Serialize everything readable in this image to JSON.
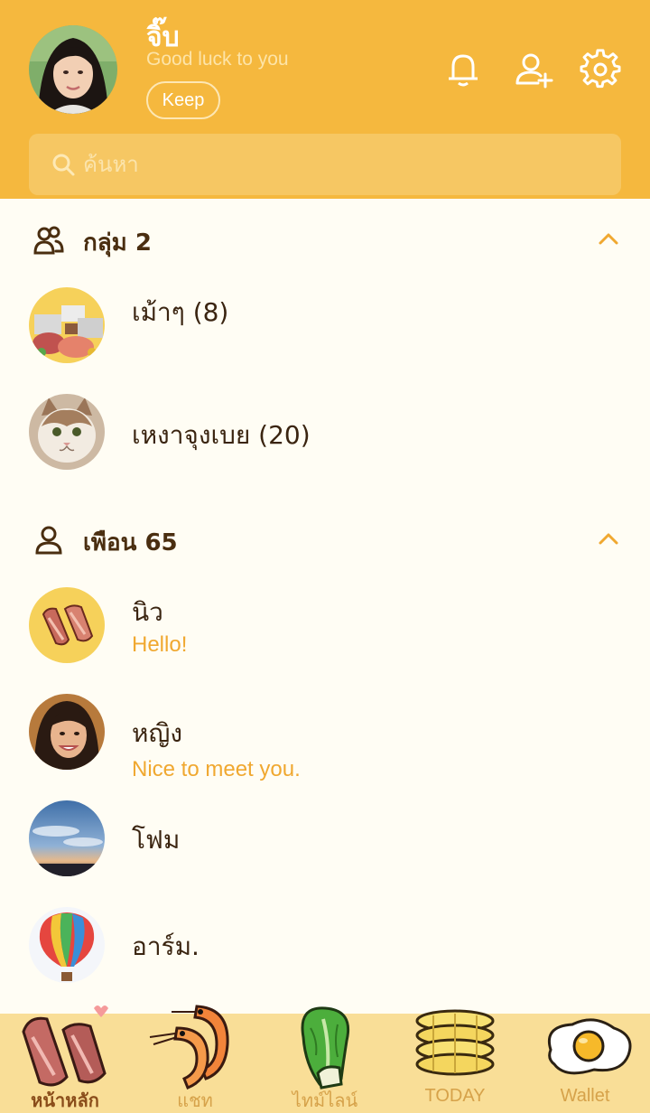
{
  "profile": {
    "name": "จิ๊บ",
    "status": "Good luck to you",
    "keep_label": "Keep"
  },
  "header_icons": [
    "bell-icon",
    "add-friend-icon",
    "gear-icon"
  ],
  "search": {
    "placeholder": "ค้นหา"
  },
  "groups": {
    "title": "กลุ่ม 2",
    "items": [
      {
        "name": "เม้าๆ (8)",
        "avatar": "food-platter-avatar"
      },
      {
        "name": "เหงาจุงเบย (20)",
        "avatar": "cat-avatar"
      }
    ]
  },
  "friends": {
    "title": "เพือน 65",
    "items": [
      {
        "name": "นิว",
        "message": "Hello!",
        "avatar": "bacon-avatar"
      },
      {
        "name": "หญิง",
        "message": "Nice to meet you.",
        "avatar": "woman-photo-avatar"
      },
      {
        "name": "โฟม",
        "message": "",
        "avatar": "sky-photo-avatar"
      },
      {
        "name": "อาร์ม.",
        "message": "",
        "avatar": "hot-air-balloon-avatar"
      }
    ]
  },
  "nav": {
    "items": [
      {
        "label": "หน้าหลัก",
        "icon": "bacon-icon",
        "active": true
      },
      {
        "label": "แชท",
        "icon": "shrimp-icon",
        "active": false
      },
      {
        "label": "ไทม์ไลน์",
        "icon": "cabbage-icon",
        "active": false
      },
      {
        "label": "TODAY",
        "icon": "corn-icon",
        "active": false
      },
      {
        "label": "Wallet",
        "icon": "fried-egg-icon",
        "active": false
      }
    ]
  },
  "colors": {
    "header": "#f5b83e",
    "background": "#fffdf4",
    "accent_text": "#f0a830",
    "dark_text": "#3a2410",
    "nav_bar": "#f9de97"
  }
}
